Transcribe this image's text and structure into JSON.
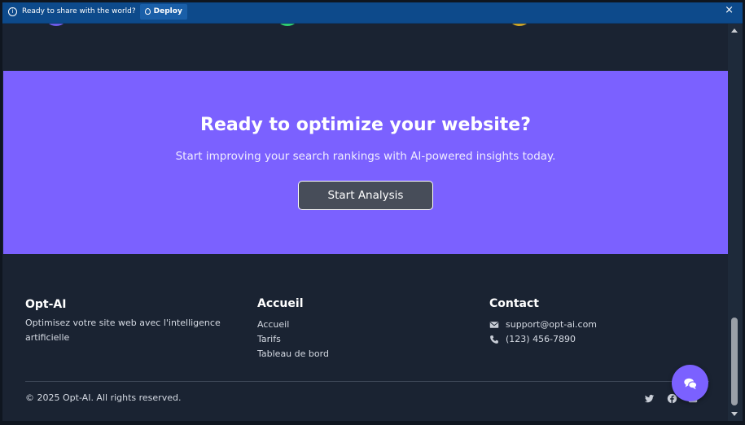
{
  "notification": {
    "message": "Ready to share with the world?",
    "deploy_label": "Deploy",
    "close_glyph": "×"
  },
  "feature_dots": {
    "colors": [
      "#6c5ce7",
      "#2ecc71",
      "#c9a227"
    ]
  },
  "cta": {
    "title": "Ready to optimize your website?",
    "subtitle": "Start improving your search rankings with AI-powered insights today.",
    "button_label": "Start Analysis",
    "background_color": "#7b61ff"
  },
  "footer": {
    "brand": {
      "title": "Opt-AI",
      "description": "Optimisez votre site web avec l'intelligence artificielle"
    },
    "links": {
      "title": "Accueil",
      "items": [
        "Accueil",
        "Tarifs",
        "Tableau de bord"
      ]
    },
    "contact": {
      "title": "Contact",
      "email": "support@opt-ai.com",
      "phone": "(123) 456-7890",
      "email_icon": "envelope-icon",
      "phone_icon": "phone-icon"
    },
    "copyright": "© 2025 Opt-AI. All rights reserved.",
    "social_icons": [
      "twitter-icon",
      "facebook-icon",
      "linkedin-icon"
    ]
  },
  "chat": {
    "icon": "chat-bubbles-icon"
  }
}
